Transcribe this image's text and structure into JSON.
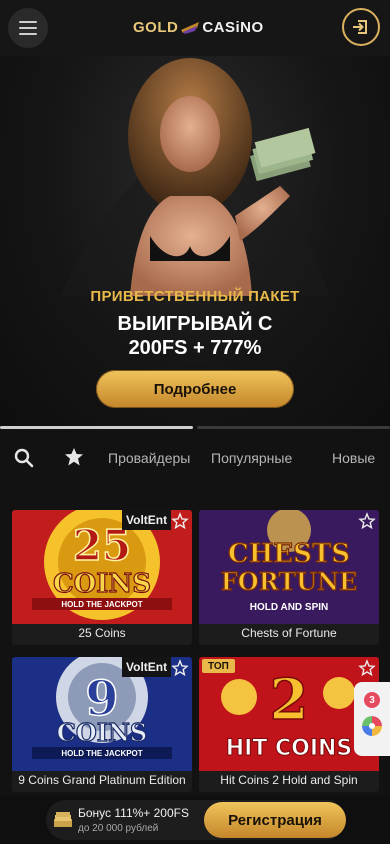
{
  "header": {
    "logo_left": "GOLD",
    "logo_right": "CASiNO",
    "menu_icon": "hamburger-icon",
    "login_icon": "login-icon"
  },
  "hero": {
    "eyebrow": "ПРИВЕТСТВЕННЫЙ ПАКЕТ",
    "title_line1": "ВЫИГРЫВАЙ С",
    "title_line2": "200FS + 777%",
    "cta": "Подробнее",
    "carousel_active_index": 1,
    "carousel_total": 2
  },
  "filters": {
    "search_icon": "search-icon",
    "favorites_icon": "star-icon",
    "items": [
      "Провайдеры",
      "Популярные",
      "Новые"
    ]
  },
  "games": [
    {
      "name": "25 Coins",
      "provider": "VoltEnt",
      "art_title": "25",
      "art_sub": "COINS",
      "art_tag": "HOLD THE JACKPOT"
    },
    {
      "name": "Chests of Fortune",
      "provider": "",
      "art_title": "CHESTS",
      "art_sub": "FORTUNE",
      "art_tag": "HOLD AND SPIN"
    },
    {
      "name": "9 Coins Grand Platinum Edition",
      "provider": "VoltEnt",
      "art_title": "9",
      "art_sub": "COINS",
      "art_tag": "HOLD THE JACKPOT"
    },
    {
      "name": "Hit Coins 2 Hold and Spin",
      "provider": "",
      "badge": "ТОП",
      "art_title": "2",
      "art_sub": "HIT COINS"
    }
  ],
  "floating_widget": {
    "count": "3",
    "icon": "wheel-icon"
  },
  "bottom_bar": {
    "bonus_line1": "Бонус 111%+ 200FS",
    "bonus_line2": "до 20 000 рублей",
    "register": "Регистрация",
    "bonus_icon": "money-stack-icon"
  },
  "colors": {
    "accent": "#e8b94a",
    "background": "#121212",
    "button_gold": "#f0c45c"
  }
}
